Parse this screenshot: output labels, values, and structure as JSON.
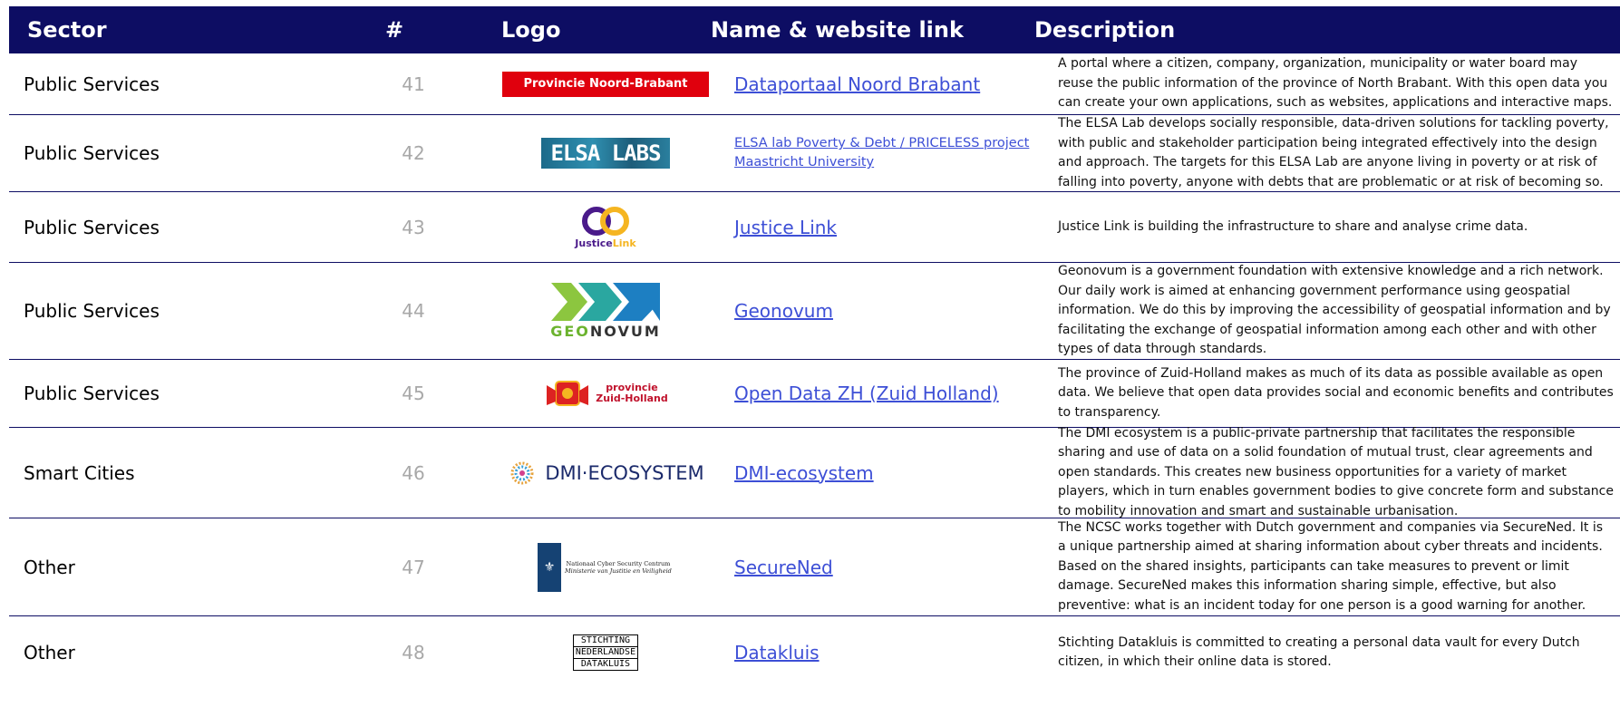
{
  "header": {
    "sector": "Sector",
    "number": "#",
    "logo": "Logo",
    "name": "Name & website link",
    "description": "Description"
  },
  "colors": {
    "header_bg": "#0d0d63",
    "link": "#3d4fd6",
    "number": "#a8a8a8"
  },
  "rows": [
    {
      "sector": "Public Services",
      "number": "41",
      "logo_text": "Provincie Noord-Brabant",
      "name": "Dataportaal Noord Brabant",
      "description": "A portal where a citizen, company, organization, municipality or water board may reuse the public information of the province of North Brabant. With this open data you can create your own applications, such as websites, applications and interactive maps."
    },
    {
      "sector": "Public Services",
      "number": "42",
      "logo_text": "ELSA LABS",
      "name": "ELSA lab Poverty & Debt / PRICELESS project Maastricht University",
      "description": "The ELSA Lab develops socially responsible, data-driven solutions for tackling poverty, with public and stakeholder participation being integrated effectively into the design and approach. The targets for this ELSA Lab are anyone living in poverty or at risk of falling into poverty, anyone with debts that are problematic or at risk of becoming so."
    },
    {
      "sector": "Public Services",
      "number": "43",
      "logo_text_a": "Justice",
      "logo_text_b": "Link",
      "name": "Justice Link",
      "description": "Justice Link is building the infrastructure to share and analyse crime data."
    },
    {
      "sector": "Public Services",
      "number": "44",
      "logo_text_a": "GEO",
      "logo_text_b": "NOVUM",
      "name": "Geonovum",
      "description": "Geonovum is a government foundation with extensive knowledge and a rich network. Our daily work is aimed at enhancing government performance using geospatial information. We do this by improving the accessibility of geospatial information and by facilitating the exchange of geospatial information among each other and with other types of data through standards."
    },
    {
      "sector": "Public Services",
      "number": "45",
      "logo_text_a": "provincie",
      "logo_text_b": "Zuid-Holland",
      "name": "Open Data ZH (Zuid Holland)",
      "description": "The province of Zuid-Holland makes as much of its data as possible available as open data. We believe that open data provides social and economic benefits and contributes to transparency."
    },
    {
      "sector": "Smart Cities",
      "number": "46",
      "logo_text": "DMI·ECOSYSTEM",
      "name": "DMI-ecosystem",
      "description": "The DMI ecosystem is a public-private partnership that facilitates the responsible sharing and use of data on a solid foundation of mutual trust, clear agreements and open standards. This creates new business opportunities for a variety of market players, which in turn enables government bodies to give concrete form and substance to mobility innovation and smart and sustainable urbanisation."
    },
    {
      "sector": "Other",
      "number": "47",
      "logo_text_a": "Nationaal Cyber Security Centrum",
      "logo_text_b": "Ministerie van Justitie en Veiligheid",
      "name": "SecureNed",
      "description": "The NCSC works together with Dutch government and companies via SecureNed. It is a unique partnership aimed at sharing information about cyber threats and incidents. Based on the shared insights, participants can take measures to prevent or limit damage. SecureNed makes this information sharing simple, effective, but also preventive: what is an incident today for one person is a good warning for another."
    },
    {
      "sector": "Other",
      "number": "48",
      "logo_lines": [
        "STICHTING",
        "NEDERLANDSE",
        "DATAKLUIS"
      ],
      "name": "Datakluis",
      "description": "Stichting Datakluis is committed to creating a personal data vault for every Dutch citizen, in which their online data is stored."
    }
  ]
}
